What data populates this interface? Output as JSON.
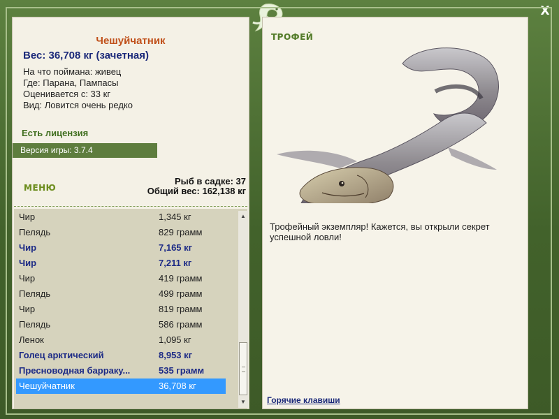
{
  "window": {
    "close_label": "X"
  },
  "fish": {
    "name": "Чешуйчатник",
    "weight": "Вес: 36,708 кг (зачетная)",
    "bait": "На что поймана: живец",
    "location": "Где: Парана, Пампасы",
    "rated_from": "Оценивается с: 33 кг",
    "rarity": "Вид: Ловится очень редко"
  },
  "license": "Есть лицензия",
  "version": "Версия игры: 3.7.4",
  "menu_label": "МЕНЮ",
  "catch_stats": {
    "count": "Рыб в садке: 37",
    "total_weight": "Общий вес: 162,138 кг"
  },
  "catch_list": [
    {
      "name": "Чир",
      "weight": "1,345 кг",
      "trophy": false,
      "selected": false
    },
    {
      "name": "Пелядь",
      "weight": "829 грамм",
      "trophy": false,
      "selected": false
    },
    {
      "name": "Чир",
      "weight": "7,165 кг",
      "trophy": true,
      "selected": false
    },
    {
      "name": "Чир",
      "weight": "7,211 кг",
      "trophy": true,
      "selected": false
    },
    {
      "name": "Чир",
      "weight": "419 грамм",
      "trophy": false,
      "selected": false
    },
    {
      "name": "Пелядь",
      "weight": "499 грамм",
      "trophy": false,
      "selected": false
    },
    {
      "name": "Чир",
      "weight": "819 грамм",
      "trophy": false,
      "selected": false
    },
    {
      "name": "Пелядь",
      "weight": "586 грамм",
      "trophy": false,
      "selected": false
    },
    {
      "name": "Ленок",
      "weight": "1,095 кг",
      "trophy": false,
      "selected": false
    },
    {
      "name": "Голец арктический",
      "weight": "8,953 кг",
      "trophy": true,
      "selected": false
    },
    {
      "name": "Пресноводная барраку...",
      "weight": "535 грамм",
      "trophy": true,
      "selected": false
    },
    {
      "name": "Чешуйчатник",
      "weight": "36,708 кг",
      "trophy": false,
      "selected": true
    }
  ],
  "trophy_panel": {
    "label": "ТРОФЕЙ",
    "message": "Трофейный экземпляр! Кажется, вы открыли секрет успешной ловли!",
    "hotkeys_link": "Горячие клавиши"
  },
  "colors": {
    "frame": "#4a6a33",
    "selected_row": "#3399ff",
    "trophy_text": "#1d2b86",
    "title": "#c0501a"
  },
  "icons": [
    "close-icon",
    "lizard-logo-icon",
    "scroll-up-icon",
    "scroll-down-icon"
  ]
}
